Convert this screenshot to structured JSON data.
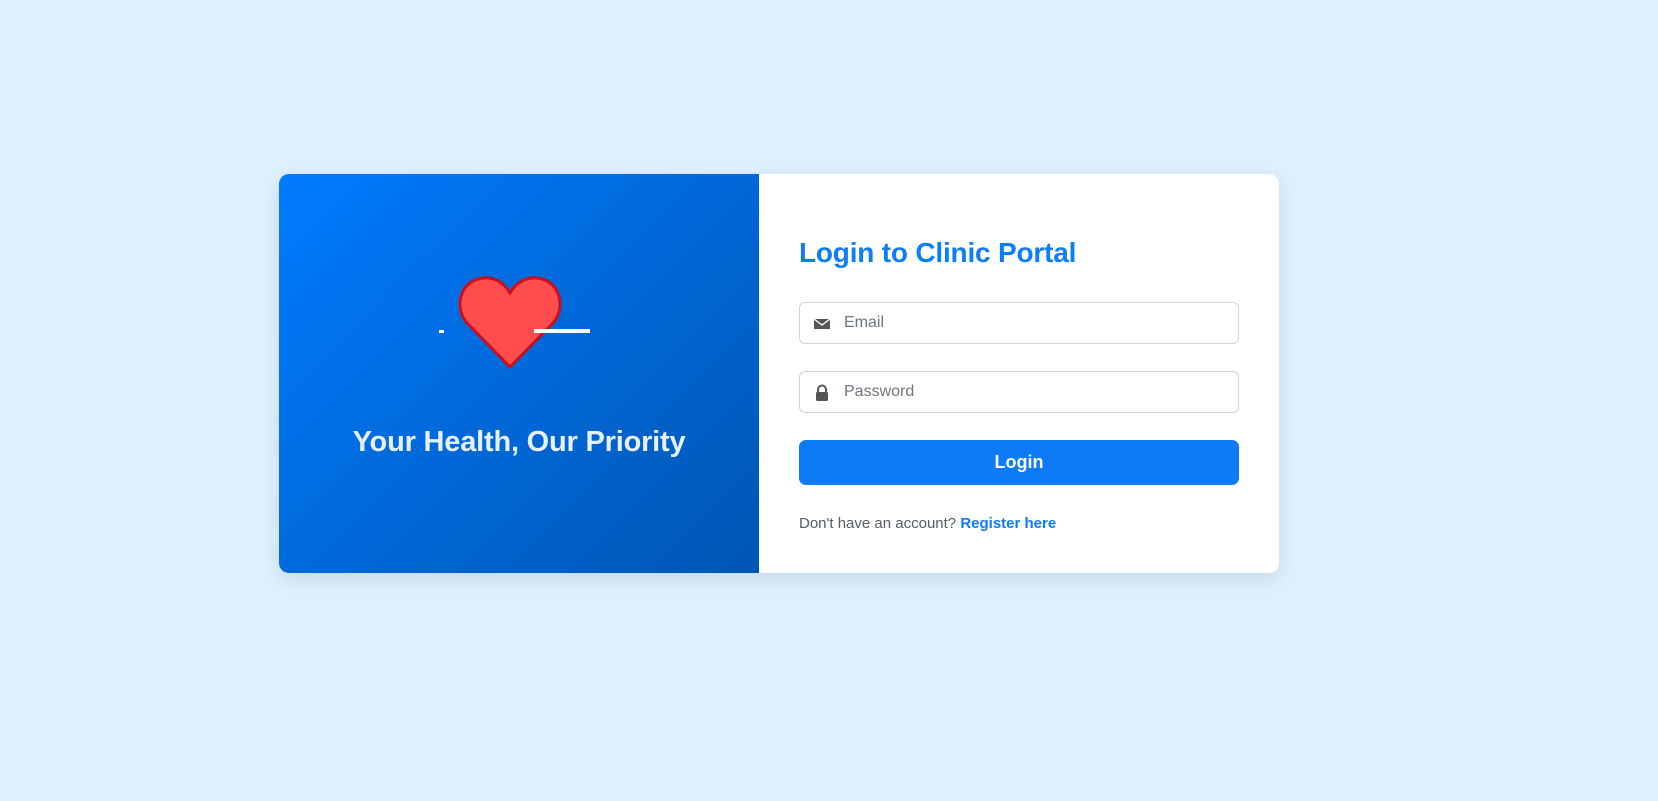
{
  "hero": {
    "illustration_icon": "heart-pulse-icon",
    "tagline": "Your Health, Our Priority"
  },
  "form": {
    "title": "Login to Clinic Portal",
    "email": {
      "icon": "envelope-icon",
      "placeholder": "Email",
      "value": ""
    },
    "password": {
      "icon": "lock-icon",
      "placeholder": "Password",
      "value": ""
    },
    "submit_label": "Login",
    "register_prompt": "Don't have an account?",
    "register_link_label": "Register here"
  },
  "colors": {
    "page_background": "#dff0fd",
    "primary": "#0d7bf5",
    "hero_gradient_start": "#007bff",
    "hero_gradient_end": "#0056b3",
    "heart_fill": "#ff4d4d",
    "heart_stroke": "#c8101e"
  }
}
